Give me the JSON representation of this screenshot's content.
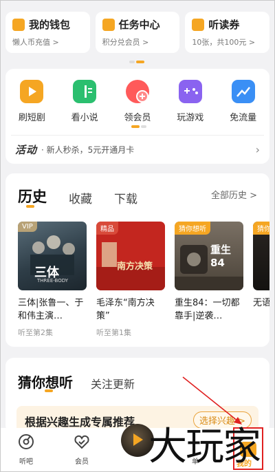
{
  "quick_cards": [
    {
      "title": "我的钱包",
      "subtitle": "懒人币充值 >",
      "icon": "wallet-icon"
    },
    {
      "title": "任务中心",
      "subtitle": "积分兑会员 >",
      "icon": "task-icon"
    },
    {
      "title": "听读券",
      "subtitle": "10张，共100元 >",
      "icon": "coupon-icon"
    }
  ],
  "entries": [
    {
      "label": "刷短剧",
      "icon": "short-drama-icon",
      "color": "#f5a623"
    },
    {
      "label": "看小说",
      "icon": "book-icon",
      "color": "#2bbf6f"
    },
    {
      "label": "领会员",
      "icon": "vip-gift-icon",
      "color": "#ff5a5a"
    },
    {
      "label": "玩游戏",
      "icon": "gamepad-icon",
      "color": "#8a63f0"
    },
    {
      "label": "免流量",
      "icon": "data-free-icon",
      "color": "#3a8ff5"
    }
  ],
  "activity": {
    "tag": "活动",
    "text": "· 新人秒杀，5元开通月卡"
  },
  "history": {
    "tabs": [
      "历史",
      "收藏",
      "下载"
    ],
    "all_label": "全部历史 >",
    "books": [
      {
        "badge": "VIP",
        "badge_color": "#b8a276",
        "title": "三体|张鲁一、于和伟主演…",
        "progress": "听至第2集",
        "cover_text": "三体",
        "cover_sub": "THREE-BODY"
      },
      {
        "badge": "精品",
        "badge_color": "#d84a3a",
        "title": "毛泽东“南方决策”",
        "progress": "听至第1集",
        "cover_text": "南方决策"
      },
      {
        "badge": "猜你想听",
        "badge_color": "#f5a623",
        "title": "重生84：一切都靠手|逆袭…",
        "progress": "",
        "cover_text": "重生84"
      },
      {
        "badge": "猜你",
        "badge_color": "#f5a623",
        "title": "无语更|",
        "progress": "",
        "cover_text": ""
      }
    ]
  },
  "guess": {
    "tabs": [
      "猜你想听",
      "关注更新"
    ],
    "banner_text": "根据兴趣生成专属推荐",
    "banner_button": "选择兴趣 >"
  },
  "bottom_nav": [
    {
      "label": "听吧",
      "icon": "listen-icon"
    },
    {
      "label": "会员",
      "icon": "vip-heart-icon"
    },
    {
      "label": "",
      "icon": "play-center-icon"
    },
    {
      "label": "单",
      "icon": "list-icon"
    },
    {
      "label": "我的",
      "icon": "mine-icon"
    }
  ],
  "watermark": "大玩家",
  "colors": {
    "accent": "#f5a623",
    "annotation": "#e02020"
  }
}
